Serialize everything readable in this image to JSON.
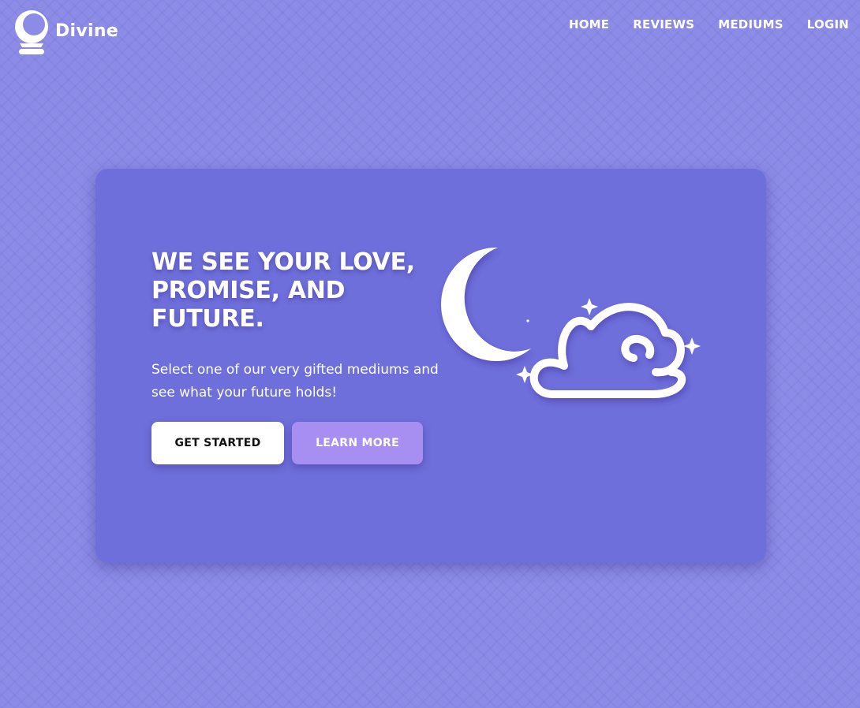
{
  "brand": {
    "name": "Divine",
    "logo_icon": "crystal-ball-icon"
  },
  "nav": {
    "items": [
      {
        "label": "HOME"
      },
      {
        "label": "REVIEWS"
      },
      {
        "label": "MEDIUMS"
      },
      {
        "label": "LOGIN"
      }
    ]
  },
  "hero": {
    "title": "WE SEE YOUR LOVE, PROMISE, AND FUTURE.",
    "subtitle": "Select one of our very gifted mediums and see what your future holds!",
    "primary_button": "GET STARTED",
    "secondary_button": "LEARN MORE",
    "illustration_icons": [
      "moon-icon",
      "cloud-icon",
      "sparkle-icon"
    ]
  },
  "colors": {
    "page_background": "#8c8ce6",
    "card_background": "#6f6fdb",
    "secondary_button": "#a68ff0",
    "text": "#ffffff"
  }
}
